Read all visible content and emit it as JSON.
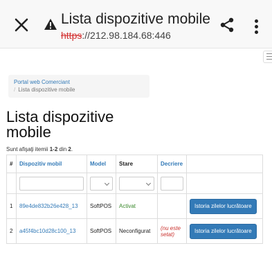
{
  "browser": {
    "page_title": "Lista dispozitive mobile",
    "url_protocol": "https",
    "url_rest": "://212.98.184.68:446"
  },
  "breadcrumb": {
    "home": "Portal web Comerciant",
    "separator": "/",
    "current": "Lista dispozitive mobile"
  },
  "page": {
    "heading": "Lista dispozitive mobile",
    "summary_prefix": "Sunt afişaţi itemii",
    "summary_range": "1-2",
    "summary_mid": "din",
    "summary_total": "2",
    "summary_end": "."
  },
  "table": {
    "columns": [
      "#",
      "Dispozitiv mobil",
      "Model",
      "Stare",
      "Decriere"
    ],
    "rows": [
      {
        "num": "1",
        "device": "89e4de832b26e428_13",
        "model": "SoftPOS",
        "status": "Activat",
        "description": "",
        "action": "Istoria zilelor lucrătoare"
      },
      {
        "num": "2",
        "device": "a45f4bc10d28c100_13",
        "model": "SoftPOS",
        "status": "Neconfigurat",
        "description": "(nu este setat)",
        "action": "Istoria zilelor lucrătoare"
      }
    ]
  },
  "colors": {
    "link": "#337ab7",
    "active_status": "#3c8a2e",
    "not_set": "#c9302c",
    "insecure_protocol": "#d32f2f"
  }
}
